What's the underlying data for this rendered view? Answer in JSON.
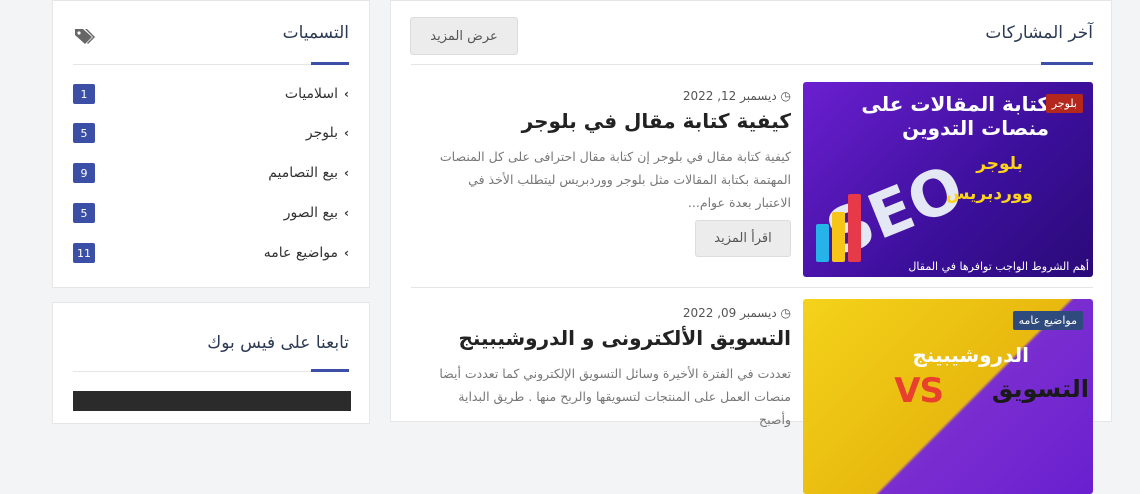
{
  "posts_section": {
    "title": "آخر المشاركات",
    "more_button": "عرض المزيد"
  },
  "posts": [
    {
      "badge": "بلوجر",
      "thumb_title": "كتابة المقالات على منصات التدوين",
      "thumb_seo": "SEO",
      "thumb_l1": "بلوجر",
      "thumb_l2": "ووردبريس",
      "thumb_foot": "أهم الشروط الواجب توافرها في المقال",
      "date": "ديسمبر 12, 2022",
      "title": "كيفية كتابة مقال في بلوجر",
      "excerpt": "كيفية كتابة مقال في بلوجر إن كتابة مقال احترافى على كل المنصات المهتمة بكتابة المقالات مثل بلوجر ووردبريس ليتطلب الأخذ في الاعتبار بعدة عوام...",
      "read_more": "اقرأ المزيد"
    },
    {
      "badge": "مواضيع عامه",
      "thumb_title": "الدروشيبينج",
      "thumb_vs": "VS",
      "thumb_l1": "التسويق",
      "date": "ديسمبر 09, 2022",
      "title": "التسويق الألكترونى و الدروشيبينج",
      "excerpt": "تعددت في الفترة الأخيرة وسائل التسويق الإلكتروني كما تعددت أيضا منصات العمل على المنتجات لتسويقها والربح منها . طريق البداية وأصبح"
    }
  ],
  "labels_widget": {
    "title": "التسميات",
    "items": [
      {
        "name": "اسلاميات",
        "count": "1"
      },
      {
        "name": "بلوجر",
        "count": "5"
      },
      {
        "name": "بيع التصاميم",
        "count": "9"
      },
      {
        "name": "بيع الصور",
        "count": "5"
      },
      {
        "name": "مواضيع عامه",
        "count": "11"
      }
    ]
  },
  "fb_widget": {
    "title": "تابعنا على فيس بوك"
  },
  "colors": {
    "accent": "#3b4fa6",
    "badge_red": "#b4271c",
    "badge_blue": "#2f4a7d"
  }
}
